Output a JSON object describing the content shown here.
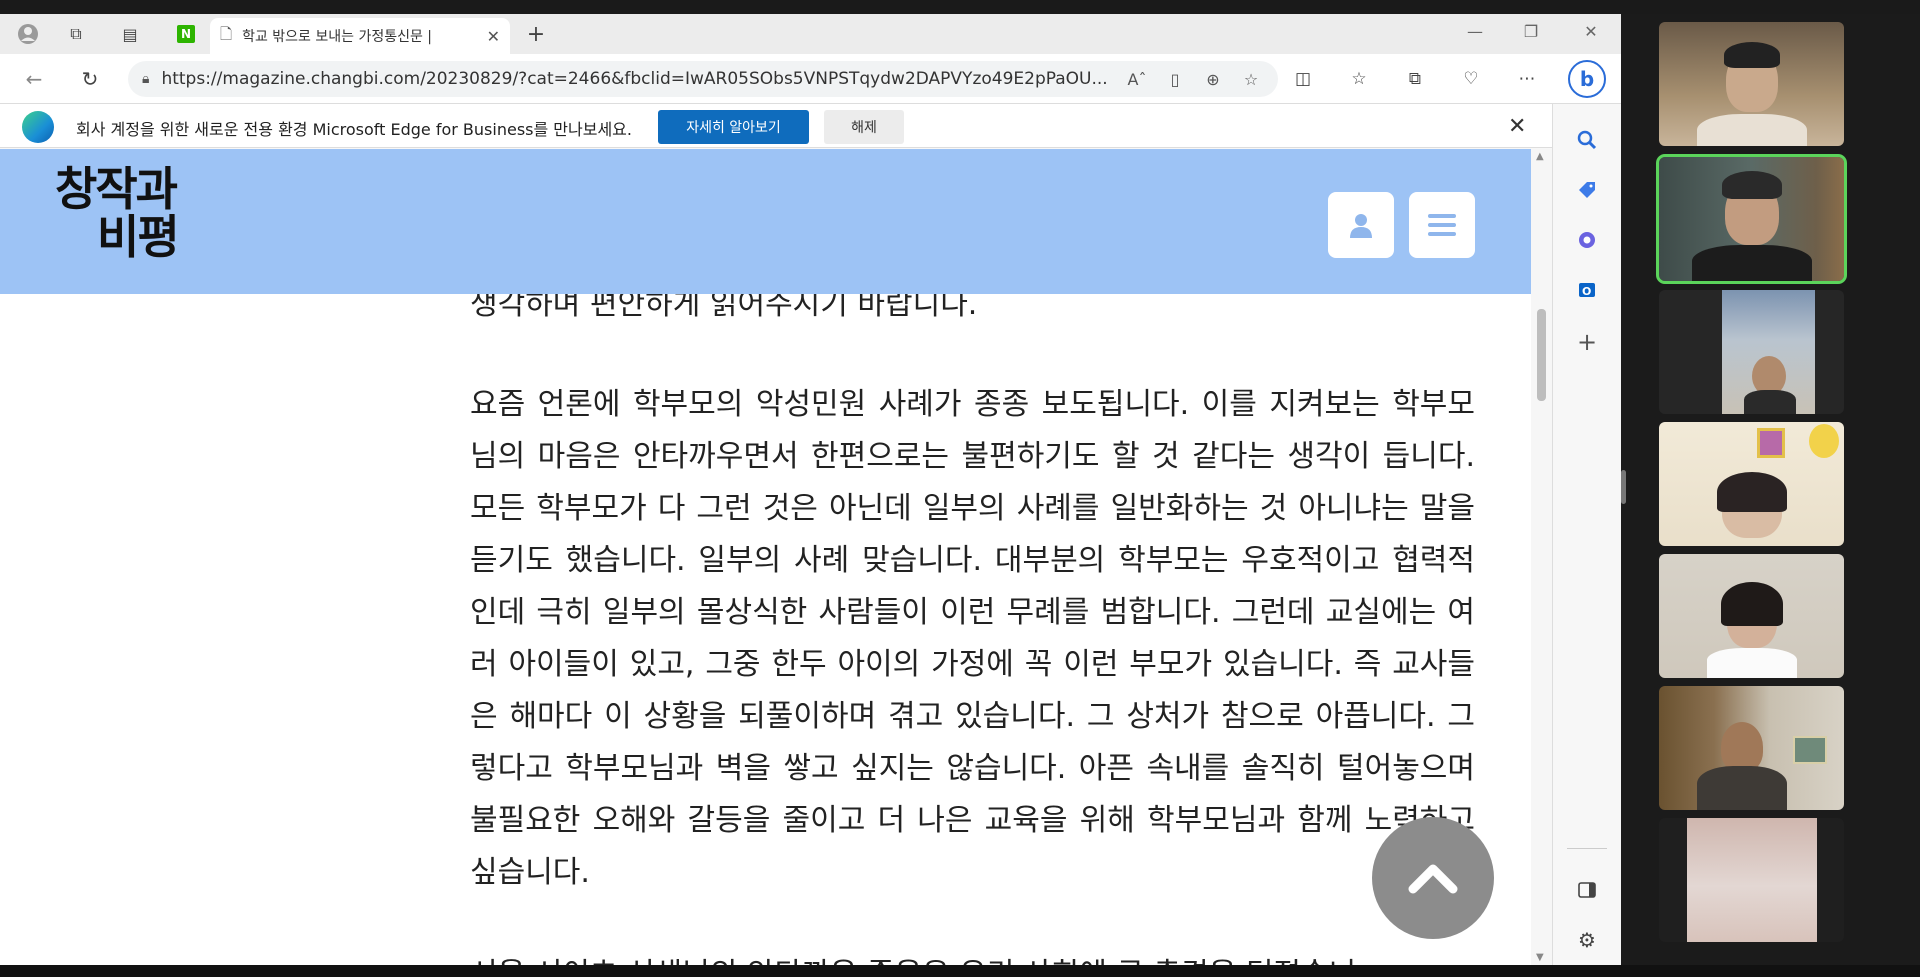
{
  "browser": {
    "tab_title": "학교 밖으로 보내는 가정통신문 |",
    "url": "https://magazine.changbi.com/20230829/?cat=2466&fbclid=IwAR05SObs5VNPSTqydw2DAPVYzo49E2pPaOU...",
    "new_tab_symbol": "+",
    "close_tab_symbol": "✕",
    "window_close_symbol": "✕"
  },
  "infobar": {
    "message": "회사 계정을 위한 새로운 전용 환경 Microsoft Edge for Business를 만나보세요.",
    "learn_more_label": "자세히 알아보기",
    "dismiss_label": "해제",
    "close_symbol": "✕"
  },
  "site": {
    "logo_line1": "창작과",
    "logo_line2": "비평"
  },
  "article": {
    "lead_partial": "생각하며 편안하게 읽어주시기 바랍니다.",
    "paragraph": "요즘 언론에 학부모의 악성민원 사례가 종종 보도됩니다. 이를 지켜보는 학부모님의 마음은 안타까우면서 한편으로는 불편하기도 할 것 같다는 생각이 듭니다. 모든 학부모가 다 그런 것은 아닌데 일부의 사례를 일반화하는 것 아니냐는 말을 듣기도 했습니다. 일부의 사례 맞습니다. 대부분의 학부모는 우호적이고 협력적인데 극히 일부의 몰상식한 사람들이 이런 무례를 범합니다. 그런데 교실에는 여러 아이들이 있고, 그중 한두 아이의 가정에 꼭 이런 부모가 있습니다. 즉 교사들은 해마다 이 상황을 되풀이하며 겪고 있습니다. 그 상처가 참으로 아픕니다. 그렇다고 학부모님과 벽을 쌓고 싶지는 않습니다. 아픈 속내를 솔직히 털어놓으며 불필요한 오해와 갈등을 줄이고 더 나은 교육을 위해 학부모님과 함께 노력하고 싶습니다.",
    "next_partial": "서울 서이초 선생님의 안타까운 죽음은 우리 사회에 큰 충격을 던졌습니"
  },
  "colors": {
    "site_header": "#9dc3f5",
    "learn_more_button": "#0f6cbd",
    "active_speaker_outline": "#5bd45b"
  },
  "icons": [
    "profile-icon",
    "workspaces-icon",
    "tab-actions-icon",
    "naver-icon",
    "page-icon",
    "back-icon",
    "refresh-icon",
    "lock-icon",
    "read-aloud-icon",
    "immersive-reader-icon",
    "zoom-icon",
    "favorite-icon",
    "split-screen-icon",
    "favorites-list-icon",
    "collections-icon",
    "browser-essentials-icon",
    "more-icon",
    "bing-icon",
    "search-icon",
    "shopping-icon",
    "copilot-icon",
    "outlook-icon",
    "add-icon",
    "sidebar-toggle-icon",
    "settings-icon",
    "user-icon",
    "menu-icon",
    "chevron-up-icon"
  ]
}
